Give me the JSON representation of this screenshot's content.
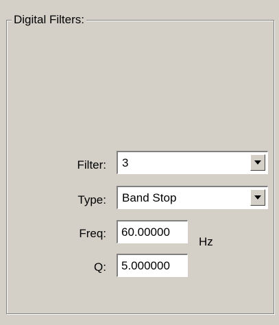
{
  "group": {
    "title": "Digital Filters:"
  },
  "filter": {
    "label": "Filter:",
    "value": "3"
  },
  "type": {
    "label": "Type:",
    "value": "Band Stop"
  },
  "freq": {
    "label": "Freq:",
    "value": "60.00000",
    "unit": "Hz"
  },
  "q": {
    "label": "Q:",
    "value": "5.000000"
  },
  "icons": {
    "dropdown": "chevron-down-icon"
  },
  "colors": {
    "background": "#d4d0c8",
    "field": "#ffffff",
    "border_dark": "#808080"
  }
}
